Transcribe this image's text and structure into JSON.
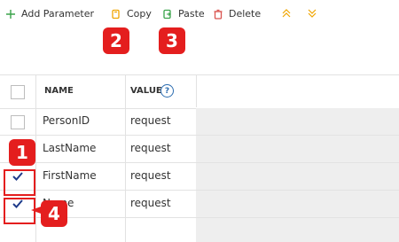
{
  "toolbar": {
    "add_label": "Add Parameter",
    "copy_label": "Copy",
    "paste_label": "Paste",
    "delete_label": "Delete",
    "icons": {
      "add": "plus-icon",
      "copy": "copy-icon",
      "paste": "paste-icon",
      "delete": "trash-icon",
      "up": "double-chevron-up-icon",
      "down": "double-chevron-down-icon"
    }
  },
  "callouts": [
    "1",
    "2",
    "3",
    "4"
  ],
  "table": {
    "headers": {
      "name": "NAME",
      "value": "VALUE"
    },
    "help_glyph": "?",
    "rows": [
      {
        "name": "PersonID",
        "value": "request",
        "checked": false
      },
      {
        "name": "LastName",
        "value": "request",
        "checked": false
      },
      {
        "name": "FirstName",
        "value": "request",
        "checked": true
      },
      {
        "name": "Name",
        "value": "request",
        "checked": true
      }
    ]
  },
  "colors": {
    "accent_blue": "#1f3a8a",
    "callout_red": "#e41e1e",
    "copy_icon": "#f0a500",
    "paste_icon": "#3aa34a",
    "delete_icon": "#d9534f"
  }
}
